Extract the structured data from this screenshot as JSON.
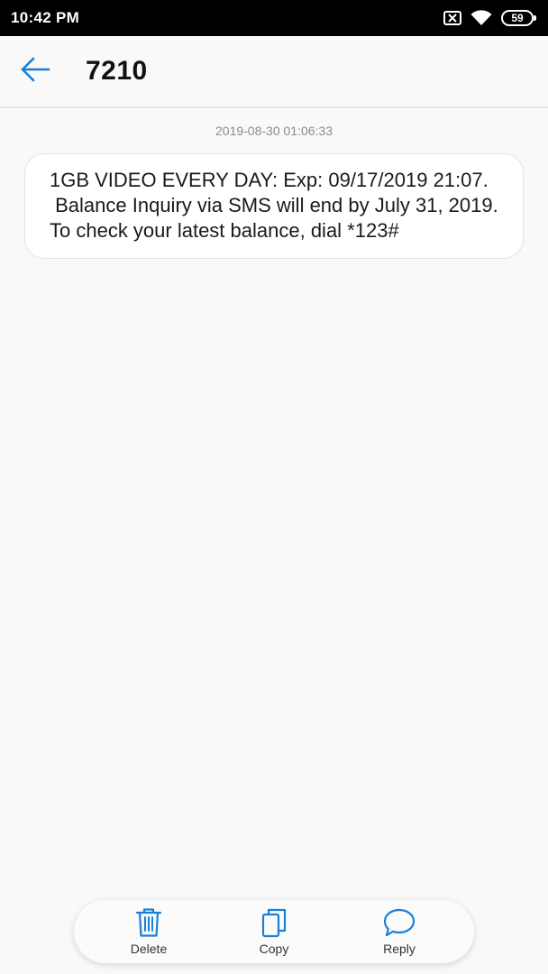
{
  "status_bar": {
    "time": "10:42 PM",
    "battery_level": "59",
    "icons": [
      "sim-blocked-icon",
      "wifi-icon",
      "battery-icon"
    ]
  },
  "header": {
    "title": "7210",
    "back_icon": "back-arrow-icon"
  },
  "conversation": {
    "timestamp": "2019-08-30 01:06:33",
    "message": "1GB VIDEO EVERY DAY: Exp: 09/17/2019 21:07.\n Balance Inquiry via SMS will end by July 31, 2019.  To check your latest balance, dial *123#"
  },
  "actions": {
    "delete_label": "Delete",
    "copy_label": "Copy",
    "reply_label": "Reply"
  },
  "colors": {
    "accent": "#1a7fd6",
    "background": "#f9f9f9",
    "status_bar": "#000000"
  }
}
